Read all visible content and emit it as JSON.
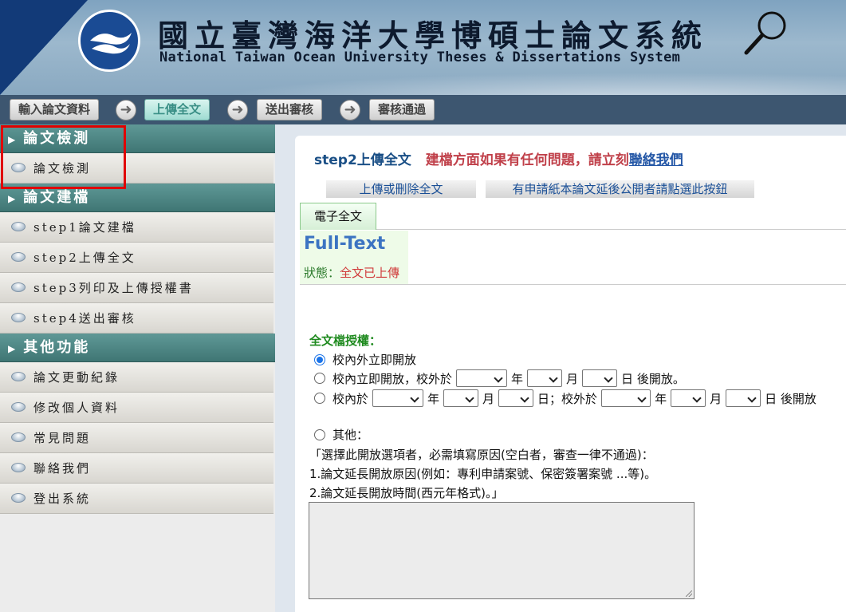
{
  "header": {
    "title_zh": "國立臺灣海洋大學博碩士論文系統",
    "title_en": "National Taiwan Ocean University   Theses & Dissertations System",
    "icons": [
      "ntou-logo",
      "magnifier-icon"
    ]
  },
  "steps": [
    {
      "label": "輸入論文資料",
      "active": false
    },
    {
      "label": "上傳全文",
      "active": true
    },
    {
      "label": "送出審核",
      "active": false
    },
    {
      "label": "審核通過",
      "active": false
    }
  ],
  "sidebar": {
    "sections": [
      {
        "title": "論文檢測",
        "items": [
          "論文檢測"
        ]
      },
      {
        "title": "論文建檔",
        "items": [
          "step1論文建檔",
          "step2上傳全文",
          "step3列印及上傳授權書",
          "step4送出審核"
        ]
      },
      {
        "title": "其他功能",
        "items": [
          "論文更動紀錄",
          "修改個人資料",
          "常見問題",
          "聯絡我們",
          "登出系統"
        ]
      }
    ]
  },
  "content": {
    "step_title": "step2上傳全文",
    "notice": "建檔方面如果有任何問題，請立刻",
    "contact_link": "聯絡我們",
    "btn_upload": "上傳或刪除全文",
    "btn_delay": "有申請紙本論文延後公開者請點選此按鈕",
    "tab": "電子全文",
    "fulltext_title": "Full-Text",
    "status_label": "狀態：",
    "status_value": "全文已上傳"
  },
  "form": {
    "label": "全文檔授權：",
    "opt1": "校內外立即開放",
    "opt2_a": "校內立即開放，校外於",
    "opt2_year": "年",
    "opt2_month": "月",
    "opt2_day": "日 後開放。",
    "opt3_a": "校內於",
    "opt3_year": "年",
    "opt3_month": "月",
    "opt3_day": "日；校外於",
    "opt3_year2": "年",
    "opt3_month2": "月",
    "opt3_day2": "日 後開放",
    "opt4": "其他：",
    "note1": "「選擇此開放選項者，必需填寫原因(空白者，審查一律不通過)：",
    "note2": "1.論文延長開放原因(例如：專利申請案號、保密簽署案號 ...等)。",
    "note3": "2.論文延長開放時間(西元年格式)。」",
    "selected": "opt1"
  }
}
